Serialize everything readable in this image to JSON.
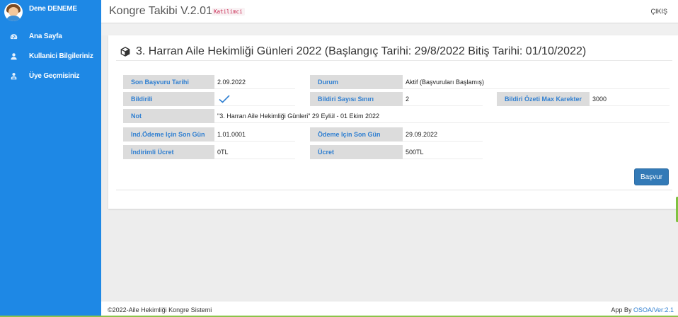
{
  "sidebar": {
    "user_name": "Dene DENEME",
    "items": [
      {
        "label": "Ana Sayfa",
        "icon": "dashboard-icon"
      },
      {
        "label": "Kullanici Bilgileriniz",
        "icon": "user-icon"
      },
      {
        "label": "Üye Geçmisiniz",
        "icon": "user-history-icon"
      }
    ]
  },
  "header": {
    "title": "Kongre Takibi V.2.01",
    "role": "Katilimci",
    "logout": "ÇIKIŞ"
  },
  "congress": {
    "title": "3. Harran Aile Hekimliği Günleri 2022 (Başlangıç Tarihi: 29/8/2022 Bitiş Tarihi: 01/10/2022)",
    "fields": {
      "son_basvuru_label": "Son Başvuru Tarihi",
      "son_basvuru_value": "2.09.2022",
      "durum_label": "Durum",
      "durum_value": "Aktif (Başvuruları Başlamış)",
      "bildirili_label": "Bildirili",
      "bildiri_sayisi_label": "Bildiri Sayısı Sınırı",
      "bildiri_sayisi_value": "2",
      "bildiri_ozeti_label": "Bildiri Özeti Max Karekter",
      "bildiri_ozeti_value": "3000",
      "not_label": "Not",
      "not_value": "\"3. Harran Aile Hekimliği Günleri\" 29 Eylül - 01 Ekim 2022",
      "ind_odeme_label": "Ind.Ödeme Için Son Gün",
      "ind_odeme_value": "1.01.0001",
      "odeme_label": "Ödeme Için Son Gün",
      "odeme_value": "29.09.2022",
      "indirimli_label": "İndirimli Ücret",
      "indirimli_value": "0TL",
      "ucret_label": "Ücret",
      "ucret_value": "500TL"
    },
    "apply_button": "Başvur"
  },
  "footer": {
    "copyright": "©2022-Aile Hekimliği Kongre Sistemi",
    "app_by": "App By",
    "link": "OSOA/Ver:2.1"
  },
  "colors": {
    "sidebar_bg": "#1e88e5",
    "label_text": "#2f7fd1",
    "label_bg": "#dcdcdc",
    "button_bg": "#337ab7"
  }
}
